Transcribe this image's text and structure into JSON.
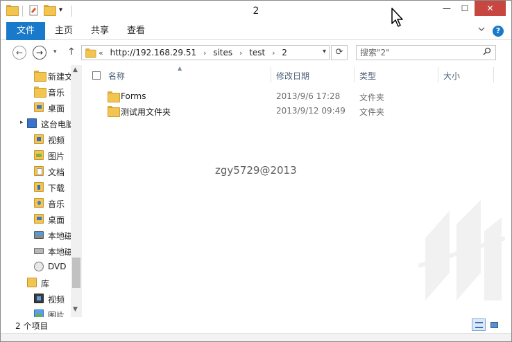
{
  "window": {
    "title": "2",
    "controls": {
      "minimize": "—",
      "maximize": "☐",
      "close": "✕"
    }
  },
  "ribbon": {
    "tabs": [
      "文件",
      "主页",
      "共享",
      "查看"
    ],
    "expand_icon": "chevron-down-icon",
    "help": "?"
  },
  "address": {
    "overflow": "«",
    "crumbs": [
      "http://192.168.29.51",
      "sites",
      "test",
      "2"
    ],
    "search_placeholder": "搜索\"2\""
  },
  "nav_pane": {
    "items": [
      {
        "label": "新建文",
        "icon": "folder"
      },
      {
        "label": "音乐",
        "icon": "folder"
      },
      {
        "label": "桌面",
        "icon": "desk"
      },
      {
        "label": "这台电脑",
        "icon": "pc"
      },
      {
        "label": "视频",
        "icon": "video"
      },
      {
        "label": "图片",
        "icon": "pic"
      },
      {
        "label": "文档",
        "icon": "doc"
      },
      {
        "label": "下载",
        "icon": "down"
      },
      {
        "label": "音乐",
        "icon": "music"
      },
      {
        "label": "桌面",
        "icon": "desk"
      },
      {
        "label": "本地磁",
        "icon": "drive-w"
      },
      {
        "label": "本地磁",
        "icon": "drive"
      },
      {
        "label": "DVD",
        "icon": "dvd"
      },
      {
        "label": "库",
        "icon": "lib"
      },
      {
        "label": "视频",
        "icon": "vid2"
      },
      {
        "label": "图片",
        "icon": "pic2"
      }
    ]
  },
  "columns": {
    "name": "名称",
    "modified": "修改日期",
    "type": "类型",
    "size": "大小"
  },
  "files": [
    {
      "name": "Forms",
      "modified": "2013/9/6 17:28",
      "type": "文件夹"
    },
    {
      "name": "测试用文件夹",
      "modified": "2013/9/12 09:49",
      "type": "文件夹"
    }
  ],
  "watermark": "zgy5729@2013",
  "status": {
    "count": "2 个项目"
  },
  "colors": {
    "accent": "#1979ca",
    "close": "#c7463f",
    "folder": "#f2c553"
  }
}
